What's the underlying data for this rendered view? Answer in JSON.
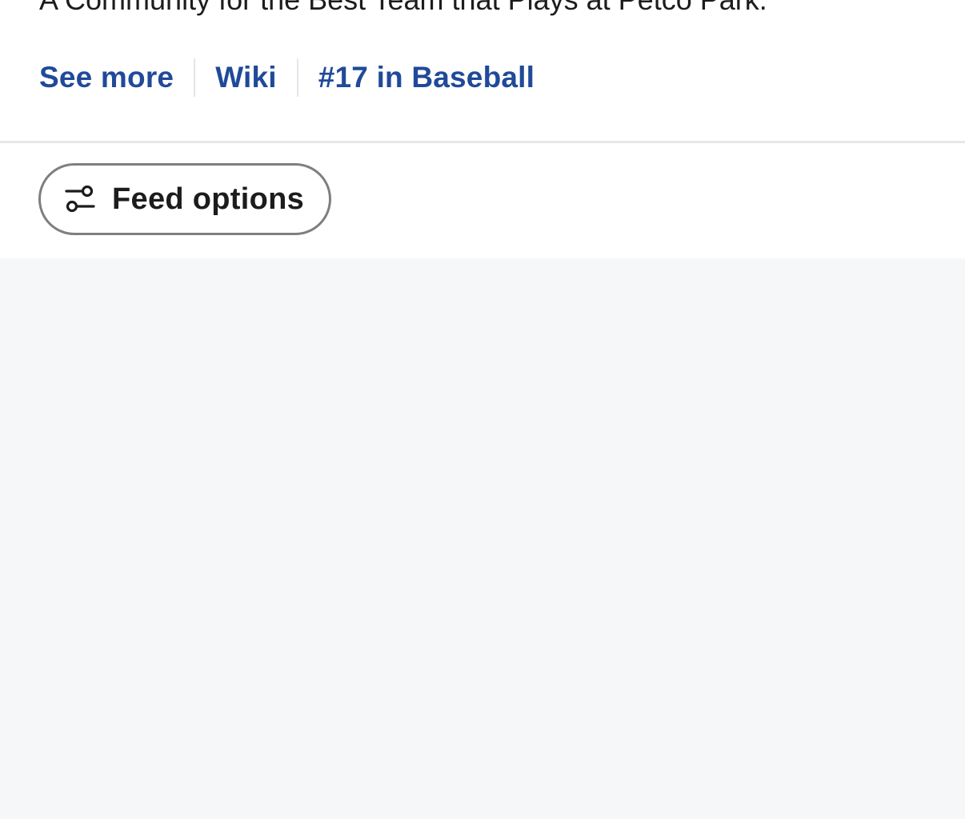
{
  "subreddit": {
    "description": "A Community for the Best Team that Plays at Petco Park.",
    "links": [
      {
        "label": "See more"
      },
      {
        "label": "Wiki"
      },
      {
        "label": "#17 in Baseball"
      }
    ]
  },
  "feed_options": {
    "label": "Feed options",
    "icon": "filter-options-icon"
  },
  "colors": {
    "link": "#204a99",
    "text": "#1c1c1c",
    "background": "#f6f7f9",
    "panel": "#ffffff"
  }
}
